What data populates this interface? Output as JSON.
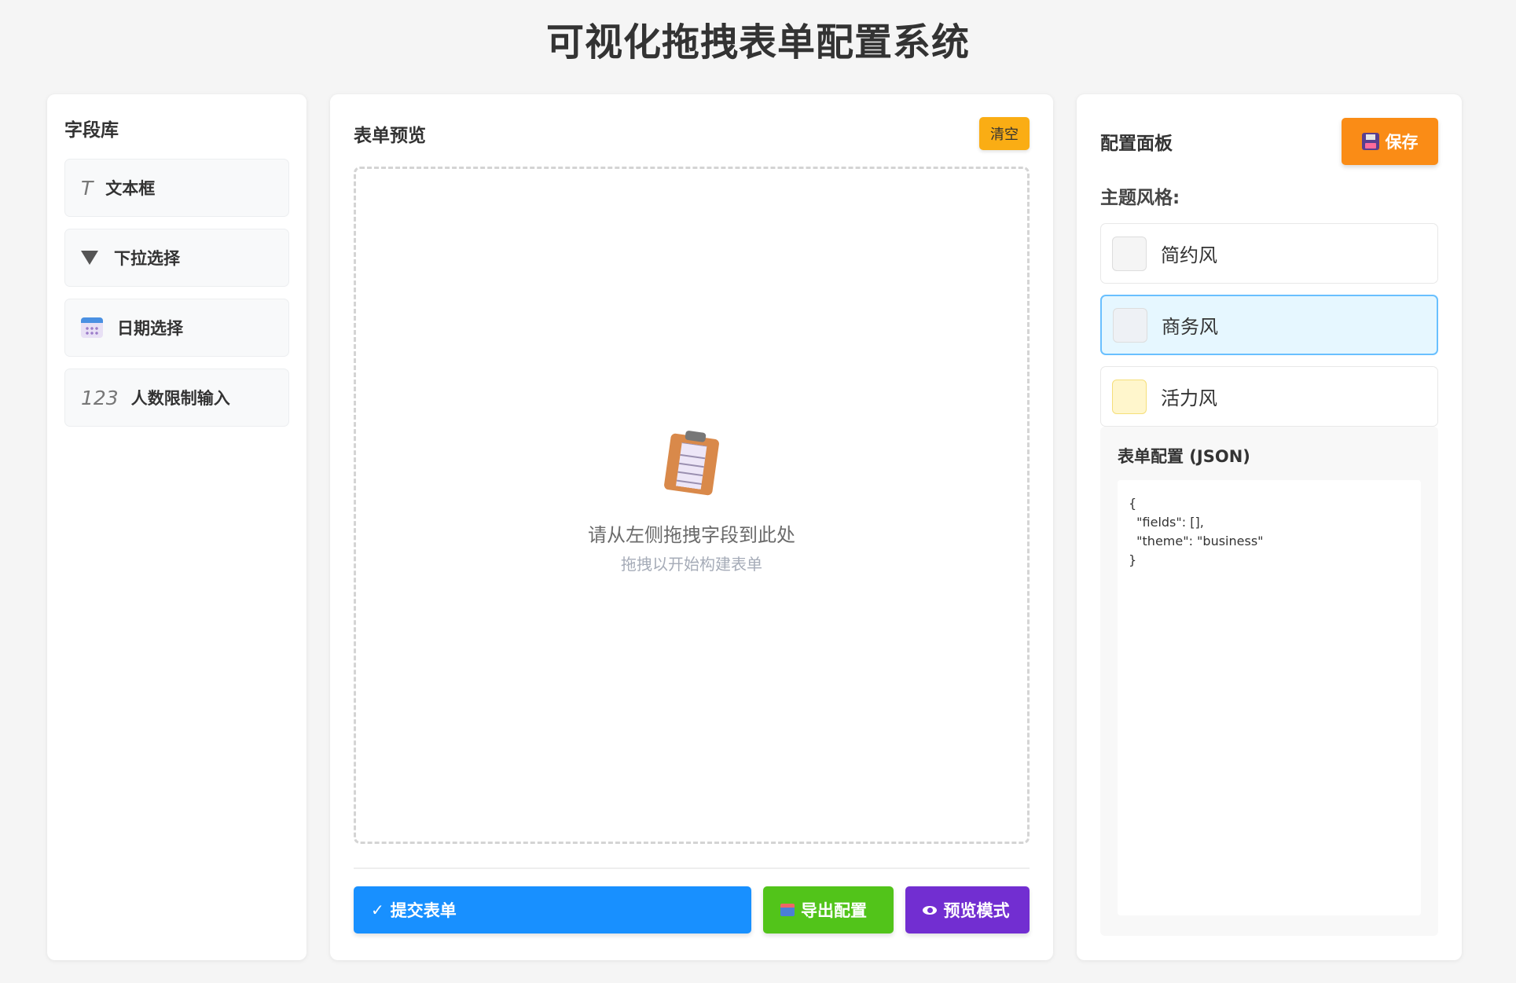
{
  "page": {
    "title": "可视化拖拽表单配置系统"
  },
  "library": {
    "title": "字段库",
    "items": [
      {
        "icon": "text-icon",
        "icon_text": "T",
        "label": "文本框"
      },
      {
        "icon": "dropdown-triangle-icon",
        "label": "下拉选择"
      },
      {
        "icon": "calendar-icon",
        "label": "日期选择"
      },
      {
        "icon": "number-icon",
        "icon_text": "123",
        "label": "人数限制输入"
      }
    ]
  },
  "preview": {
    "title": "表单预览",
    "clear_label": "清空",
    "empty_main": "请从左侧拖拽字段到此处",
    "empty_sub": "拖拽以开始构建表单",
    "submit_icon": "✓",
    "submit_label": "提交表单",
    "export_label": "导出配置",
    "preview_label": "预览模式"
  },
  "config": {
    "title": "配置面板",
    "save_label": "保存",
    "theme_label": "主题风格:",
    "themes": [
      {
        "name": "简约风",
        "swatch": "#f5f5f5",
        "active": false
      },
      {
        "name": "商务风",
        "swatch": "#eef1f5",
        "active": true
      },
      {
        "name": "活力风",
        "swatch": "#fff6cc",
        "active": false
      }
    ],
    "json_title": "表单配置 (JSON)",
    "json_text": "{\n  \"fields\": [],\n  \"theme\": \"business\"\n}"
  },
  "colors": {
    "primary": "#1890ff",
    "success": "#52c41a",
    "purple": "#722ed1",
    "orange": "#fa8c16",
    "warning": "#faad14"
  }
}
